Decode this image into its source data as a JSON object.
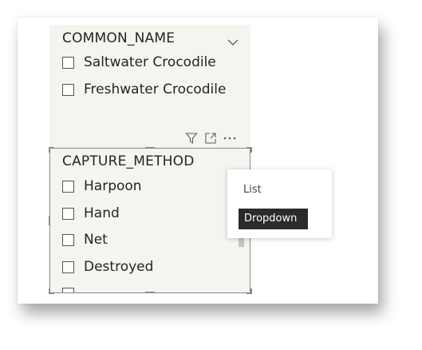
{
  "top_slicer": {
    "title": "COMMON_NAME",
    "items": [
      {
        "label": "Saltwater Crocodile",
        "checked": false
      },
      {
        "label": "Freshwater Crocodile",
        "checked": false
      }
    ]
  },
  "bottom_slicer": {
    "title": "CAPTURE_METHOD",
    "items": [
      {
        "label": "Harpoon",
        "checked": false
      },
      {
        "label": "Hand",
        "checked": false
      },
      {
        "label": "Net",
        "checked": false
      },
      {
        "label": "Destroyed",
        "checked": false
      }
    ]
  },
  "header_icons": [
    "filter-icon",
    "focus-mode-icon",
    "more-options-icon"
  ],
  "style_menu": {
    "options": [
      "List",
      "Dropdown"
    ],
    "selected": "Dropdown"
  },
  "colors": {
    "slicer_bg": "#f6f4ef",
    "selected_menu_bg": "#2b2b2b",
    "text": "#252423"
  }
}
